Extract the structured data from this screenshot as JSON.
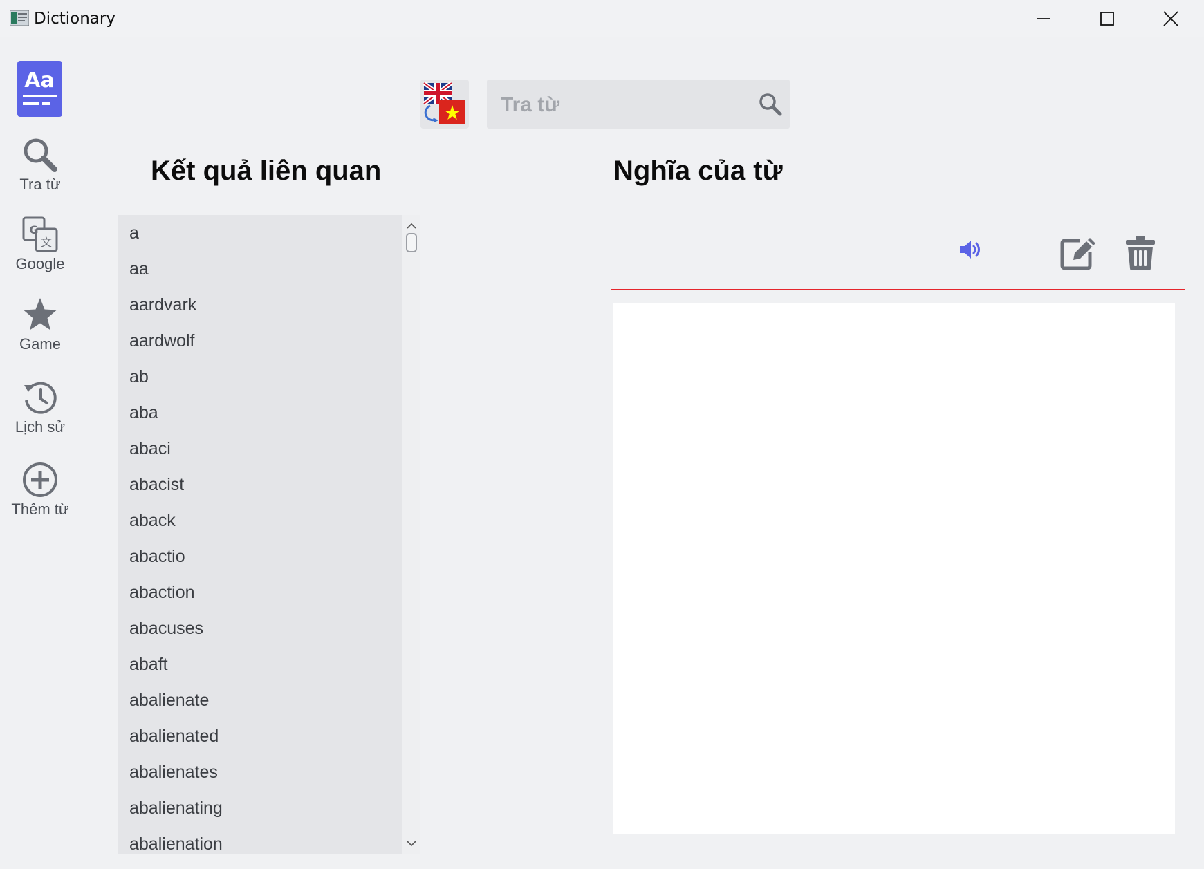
{
  "window": {
    "title": "Dictionary"
  },
  "sidebar": {
    "logo_text": "Aa",
    "items": [
      {
        "label": "Tra từ",
        "icon": "search-icon"
      },
      {
        "label": "Google",
        "icon": "google-translate-icon"
      },
      {
        "label": "Game",
        "icon": "star-icon"
      },
      {
        "label": "Lịch sử",
        "icon": "history-icon"
      },
      {
        "label": "Thêm từ",
        "icon": "add-circle-icon"
      }
    ]
  },
  "search": {
    "placeholder": "Tra từ",
    "value": "",
    "language_toggle": "en-vi-flag-icon"
  },
  "related": {
    "heading": "Kết quả liên quan",
    "words": [
      "a",
      "aa",
      "aardvark",
      "aardwolf",
      "ab",
      "aba",
      "abaci",
      "abacist",
      "aback",
      "abactio",
      "abaction",
      "abacuses",
      "abaft",
      "abalienate",
      "abalienated",
      "abalienates",
      "abalienating",
      "abalienation"
    ]
  },
  "meaning": {
    "heading": "Nghĩa của từ",
    "content": ""
  },
  "colors": {
    "accent": "#5b63e6",
    "divider": "#e5262c",
    "icon_gray": "#6c7078",
    "list_bg": "#e4e5e8",
    "window_bg": "#f0f1f3"
  }
}
